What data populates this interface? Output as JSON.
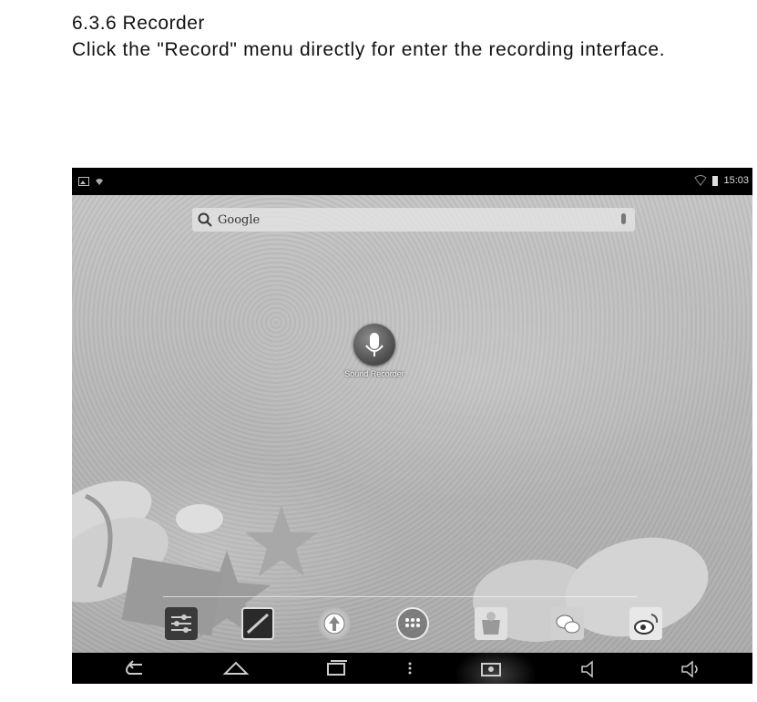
{
  "document": {
    "heading": "6.3.6 Recorder",
    "instruction": "Click the \"Record\" menu directly for enter the recording interface."
  },
  "tablet": {
    "status_bar": {
      "time": "15:03"
    },
    "search": {
      "label": "Google"
    },
    "app": {
      "label": "Sound Recorder"
    },
    "dock_icons": [
      "settings-icon",
      "gallery-icon",
      "upload-icon",
      "app-drawer-icon",
      "store-icon",
      "wechat-icon",
      "weibo-icon"
    ],
    "nav_buttons": [
      "back-icon",
      "home-icon",
      "recent-apps-icon",
      "menu-icon",
      "screenshot-icon",
      "volume-down-icon",
      "volume-up-icon"
    ],
    "colors": {
      "bar": "#000000",
      "wallpaper": "#b9b9b9"
    }
  }
}
